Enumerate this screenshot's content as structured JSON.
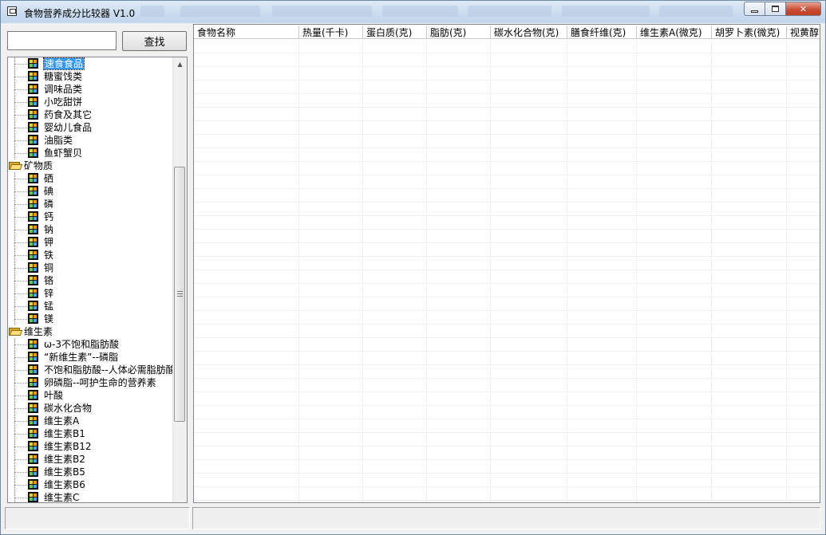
{
  "window": {
    "title": "食物营养成分比较器 V1.0"
  },
  "search": {
    "value": "",
    "button_label": "查找"
  },
  "tree": {
    "rows": [
      {
        "type": "leaf",
        "label": "速食食品",
        "selected": true
      },
      {
        "type": "leaf",
        "label": "糖蜜饯类"
      },
      {
        "type": "leaf",
        "label": "调味品类"
      },
      {
        "type": "leaf",
        "label": "小吃甜饼"
      },
      {
        "type": "leaf",
        "label": "药食及其它"
      },
      {
        "type": "leaf",
        "label": "婴幼儿食品"
      },
      {
        "type": "leaf",
        "label": "油脂类"
      },
      {
        "type": "leaf",
        "label": "鱼虾蟹贝"
      },
      {
        "type": "folder",
        "label": "矿物质"
      },
      {
        "type": "leaf",
        "label": "硒"
      },
      {
        "type": "leaf",
        "label": "碘"
      },
      {
        "type": "leaf",
        "label": "磷"
      },
      {
        "type": "leaf",
        "label": "钙"
      },
      {
        "type": "leaf",
        "label": "钠"
      },
      {
        "type": "leaf",
        "label": "钾"
      },
      {
        "type": "leaf",
        "label": "铁"
      },
      {
        "type": "leaf",
        "label": "铜"
      },
      {
        "type": "leaf",
        "label": "铬"
      },
      {
        "type": "leaf",
        "label": "锌"
      },
      {
        "type": "leaf",
        "label": "锰"
      },
      {
        "type": "leaf",
        "label": "镁"
      },
      {
        "type": "folder",
        "label": "维生素"
      },
      {
        "type": "leaf",
        "label": "ω-3不饱和脂肪酸"
      },
      {
        "type": "leaf",
        "label": "“新维生素”--磷脂"
      },
      {
        "type": "leaf",
        "label": "不饱和脂肪酸--人体必需脂肪酸"
      },
      {
        "type": "leaf",
        "label": "卵磷脂--呵护生命的营养素"
      },
      {
        "type": "leaf",
        "label": "叶酸"
      },
      {
        "type": "leaf",
        "label": "碳水化合物"
      },
      {
        "type": "leaf",
        "label": "维生素A"
      },
      {
        "type": "leaf",
        "label": "维生素B1"
      },
      {
        "type": "leaf",
        "label": "维生素B12"
      },
      {
        "type": "leaf",
        "label": "维生素B2"
      },
      {
        "type": "leaf",
        "label": "维生素B5"
      },
      {
        "type": "leaf",
        "label": "维生素B6"
      },
      {
        "type": "leaf",
        "label": "维生素C"
      }
    ]
  },
  "grid": {
    "columns": [
      "食物名称",
      "热量(千卡)",
      "蛋白质(克)",
      "脂肪(克)",
      "碳水化合物(克)",
      "膳食纤维(克)",
      "维生素A(微克)",
      "胡罗卜素(微克)",
      "视黄醇"
    ]
  },
  "status": {
    "left": "",
    "right": ""
  }
}
